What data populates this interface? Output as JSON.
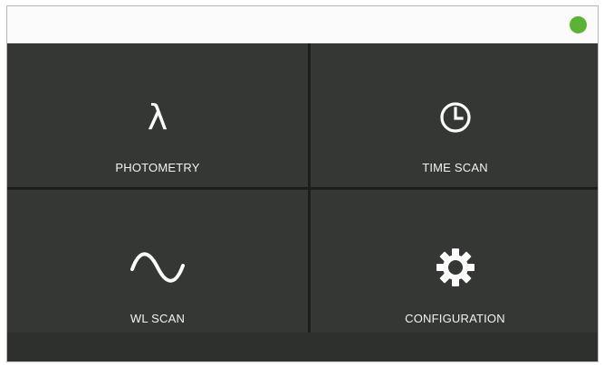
{
  "status": {
    "indicator_color": "#5cb233",
    "indicator_state": "connected"
  },
  "tiles": [
    {
      "label": "PHOTOMETRY",
      "icon": "lambda-icon",
      "glyph": "λ"
    },
    {
      "label": "TIME SCAN",
      "icon": "clock-icon"
    },
    {
      "label": "WL SCAN",
      "icon": "sine-wave-icon"
    },
    {
      "label": "CONFIGURATION",
      "icon": "gear-icon"
    }
  ],
  "colors": {
    "background": "#2e302e",
    "tile": "#353735",
    "statusbar": "#fbfbfb",
    "text": "#f2f2f2"
  }
}
